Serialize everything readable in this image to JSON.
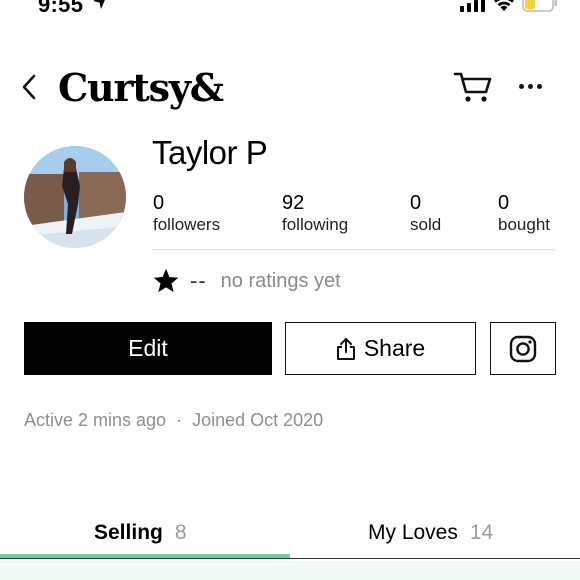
{
  "status_bar": {
    "time": "9:55"
  },
  "nav": {
    "logo": "Curtsy&"
  },
  "profile": {
    "name": "Taylor P",
    "stats": [
      {
        "value": "0",
        "label": "followers"
      },
      {
        "value": "92",
        "label": "following"
      },
      {
        "value": "0",
        "label": "sold"
      },
      {
        "value": "0",
        "label": "bought"
      }
    ],
    "rating_dash": "--",
    "rating_text": "no ratings yet",
    "active": "Active 2 mins ago",
    "separator": "·",
    "joined": "Joined Oct 2020"
  },
  "actions": {
    "edit_label": "Edit",
    "share_label": "Share"
  },
  "tabs": [
    {
      "label": "Selling",
      "count": "8"
    },
    {
      "label": "My Loves",
      "count": "14"
    }
  ],
  "colors": {
    "accent": "#6bd29b",
    "battery": "#f5d23a"
  },
  "icons": {
    "back": "chevron-left-icon",
    "cart": "cart-icon",
    "more": "more-dots-icon",
    "star": "star-icon",
    "share": "share-icon",
    "instagram": "instagram-icon"
  }
}
